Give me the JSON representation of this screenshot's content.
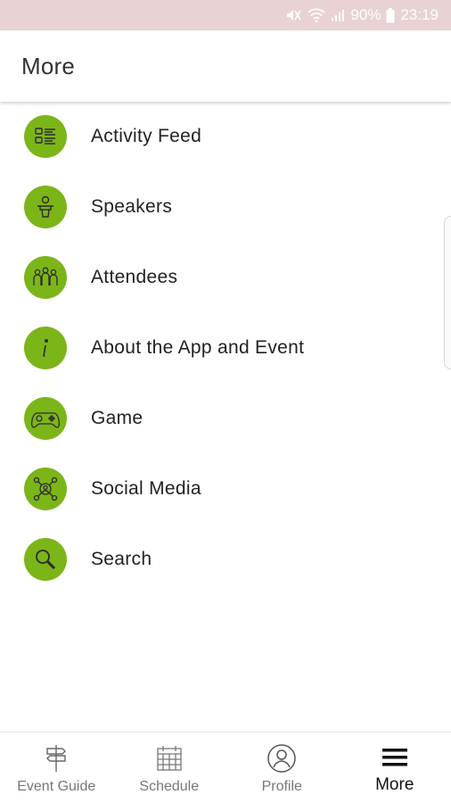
{
  "status_bar": {
    "battery": "90%",
    "time": "23:19",
    "icons": [
      "mute-icon",
      "wifi-icon",
      "signal-icon",
      "battery-icon"
    ],
    "background": "#e8d2d4"
  },
  "header": {
    "title": "More"
  },
  "menu": {
    "accent_color": "#7cb518",
    "items": [
      {
        "label": "Activity Feed",
        "icon": "activity-feed-icon"
      },
      {
        "label": "Speakers",
        "icon": "speaker-icon"
      },
      {
        "label": "Attendees",
        "icon": "attendees-icon"
      },
      {
        "label": "About the App and Event",
        "icon": "info-icon"
      },
      {
        "label": "Game",
        "icon": "gamepad-icon"
      },
      {
        "label": "Social Media",
        "icon": "social-network-icon"
      },
      {
        "label": "Search",
        "icon": "search-icon"
      }
    ]
  },
  "bottom_nav": {
    "items": [
      {
        "label": "Event Guide",
        "icon": "signpost-icon",
        "active": false
      },
      {
        "label": "Schedule",
        "icon": "calendar-icon",
        "active": false
      },
      {
        "label": "Profile",
        "icon": "profile-icon",
        "active": false
      },
      {
        "label": "More",
        "icon": "hamburger-menu-icon",
        "active": true
      }
    ]
  }
}
